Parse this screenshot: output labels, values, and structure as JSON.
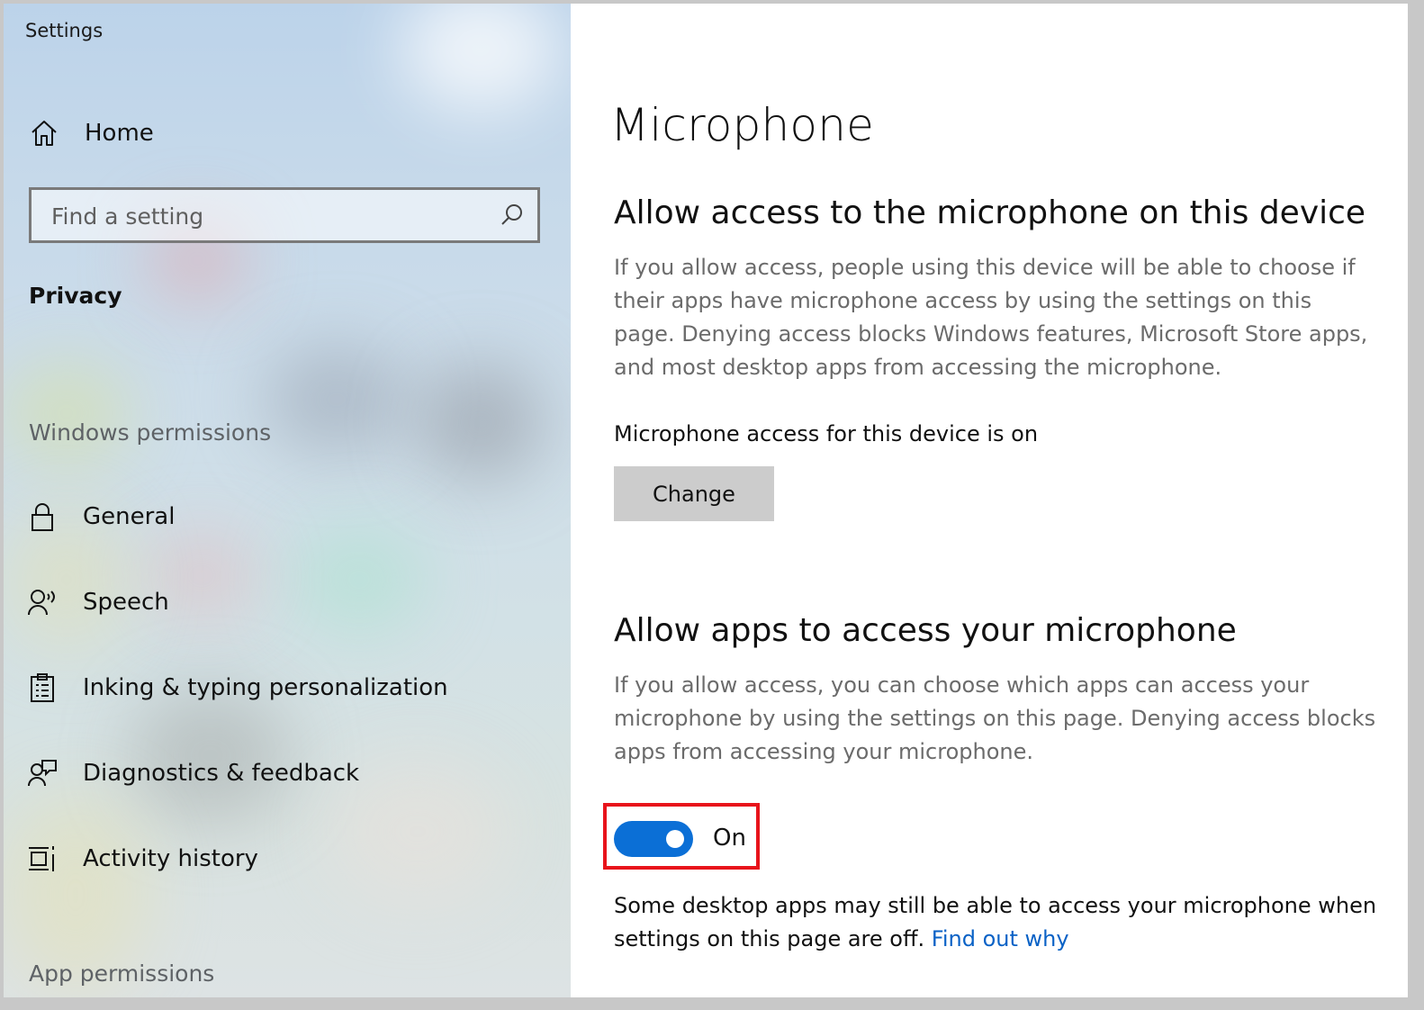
{
  "window": {
    "title": "Settings"
  },
  "sidebar": {
    "home": {
      "label": "Home",
      "icon": "home-icon"
    },
    "search": {
      "placeholder": "Find a setting",
      "value": "",
      "icon": "search-icon"
    },
    "current_section": "Privacy",
    "groups": [
      {
        "label": "Windows permissions",
        "items": [
          {
            "label": "General",
            "icon": "lock-icon"
          },
          {
            "label": "Speech",
            "icon": "speech-icon"
          },
          {
            "label": "Inking & typing personalization",
            "icon": "clipboard-icon"
          },
          {
            "label": "Diagnostics & feedback",
            "icon": "feedback-icon"
          },
          {
            "label": "Activity history",
            "icon": "timeline-icon"
          }
        ]
      },
      {
        "label": "App permissions",
        "items": []
      }
    ]
  },
  "main": {
    "page_title": "Microphone",
    "device_access": {
      "heading": "Allow access to the microphone on this device",
      "description": "If you allow access, people using this device will be able to choose if their apps have microphone access by using the settings on this page. Denying access blocks Windows features, Microsoft Store apps, and most desktop apps from accessing the microphone.",
      "status": "Microphone access for this device is on",
      "button_label": "Change"
    },
    "app_access": {
      "heading": "Allow apps to access your microphone",
      "description": "If you allow access, you can choose which apps can access your microphone by using the settings on this page. Denying access blocks apps from accessing your microphone.",
      "toggle_state": "on",
      "toggle_label": "On"
    },
    "note": {
      "text": "Some desktop apps may still be able to access your microphone when settings on this page are off.",
      "link_label": "Find out why"
    }
  },
  "colors": {
    "accent": "#0b6fd6",
    "link": "#0a62c6",
    "highlight": "#e8141b",
    "button_bg": "#cccccc",
    "description_text": "#6b6b6b"
  }
}
